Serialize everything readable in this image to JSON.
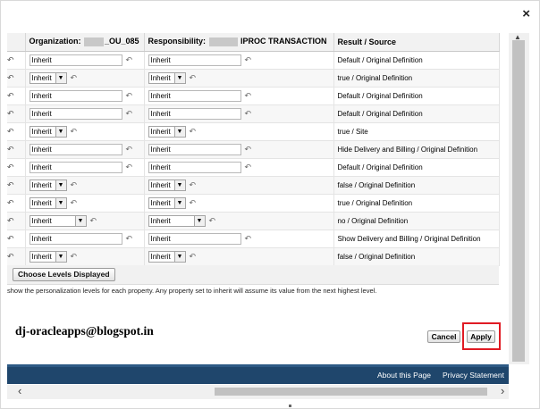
{
  "window": {
    "close_symbol": "×"
  },
  "table": {
    "headers": {
      "organization_label": "Organization:",
      "organization_value": "_OU_085",
      "responsibility_label": "Responsibility:",
      "responsibility_value": "IPROC TRANSACTION",
      "result_source": "Result / Source"
    },
    "revert_glyph": "↶",
    "rows": [
      {
        "org": "Inherit",
        "org_type": "text",
        "resp": "Inherit",
        "resp_type": "text",
        "result": "Default / Original Definition"
      },
      {
        "org": "Inherit",
        "org_type": "select",
        "resp": "Inherit",
        "resp_type": "select",
        "result": "true / Original Definition"
      },
      {
        "org": "Inherit",
        "org_type": "text",
        "resp": "Inherit",
        "resp_type": "text",
        "result": "Default / Original Definition"
      },
      {
        "org": "Inherit",
        "org_type": "text",
        "resp": "Inherit",
        "resp_type": "text",
        "result": "Default / Original Definition"
      },
      {
        "org": "Inherit",
        "org_type": "select",
        "resp": "Inherit",
        "resp_type": "select",
        "result": "true / Site"
      },
      {
        "org": "Inherit",
        "org_type": "text",
        "resp": "Inherit",
        "resp_type": "text",
        "result": "Hide Delivery and Billing / Original Definition"
      },
      {
        "org": "Inherit",
        "org_type": "text",
        "resp": "Inherit",
        "resp_type": "text",
        "result": "Default / Original Definition"
      },
      {
        "org": "Inherit",
        "org_type": "select",
        "resp": "Inherit",
        "resp_type": "select",
        "result": "false / Original Definition"
      },
      {
        "org": "Inherit",
        "org_type": "select",
        "resp": "Inherit",
        "resp_type": "select",
        "result": "true / Original Definition"
      },
      {
        "org": "Inherit",
        "org_type": "select-wide",
        "resp": "Inherit",
        "resp_type": "select-wide",
        "result": "no / Original Definition"
      },
      {
        "org": "Inherit",
        "org_type": "text",
        "resp": "Inherit",
        "resp_type": "text",
        "result": "Show Delivery and Billing / Original Definition"
      },
      {
        "org": "Inherit",
        "org_type": "select",
        "resp": "Inherit",
        "resp_type": "select",
        "result": "false / Original Definition"
      }
    ]
  },
  "buttons": {
    "choose_levels": "Choose Levels Displayed",
    "cancel": "Cancel",
    "apply": "Apply"
  },
  "instructions": "show the personalization levels for each property. Any property set to inherit will assume its value from the next highest level.",
  "watermark": "dj-oracleapps@blogspot.in",
  "footer": {
    "about": "About this Page",
    "privacy": "Privacy Statement"
  },
  "scrollbar": {
    "left_arrow": "‹",
    "right_arrow": "›",
    "up_arrow": "▲"
  },
  "colors": {
    "footer_bg": "#1f466c",
    "highlight": "#e01b24"
  }
}
